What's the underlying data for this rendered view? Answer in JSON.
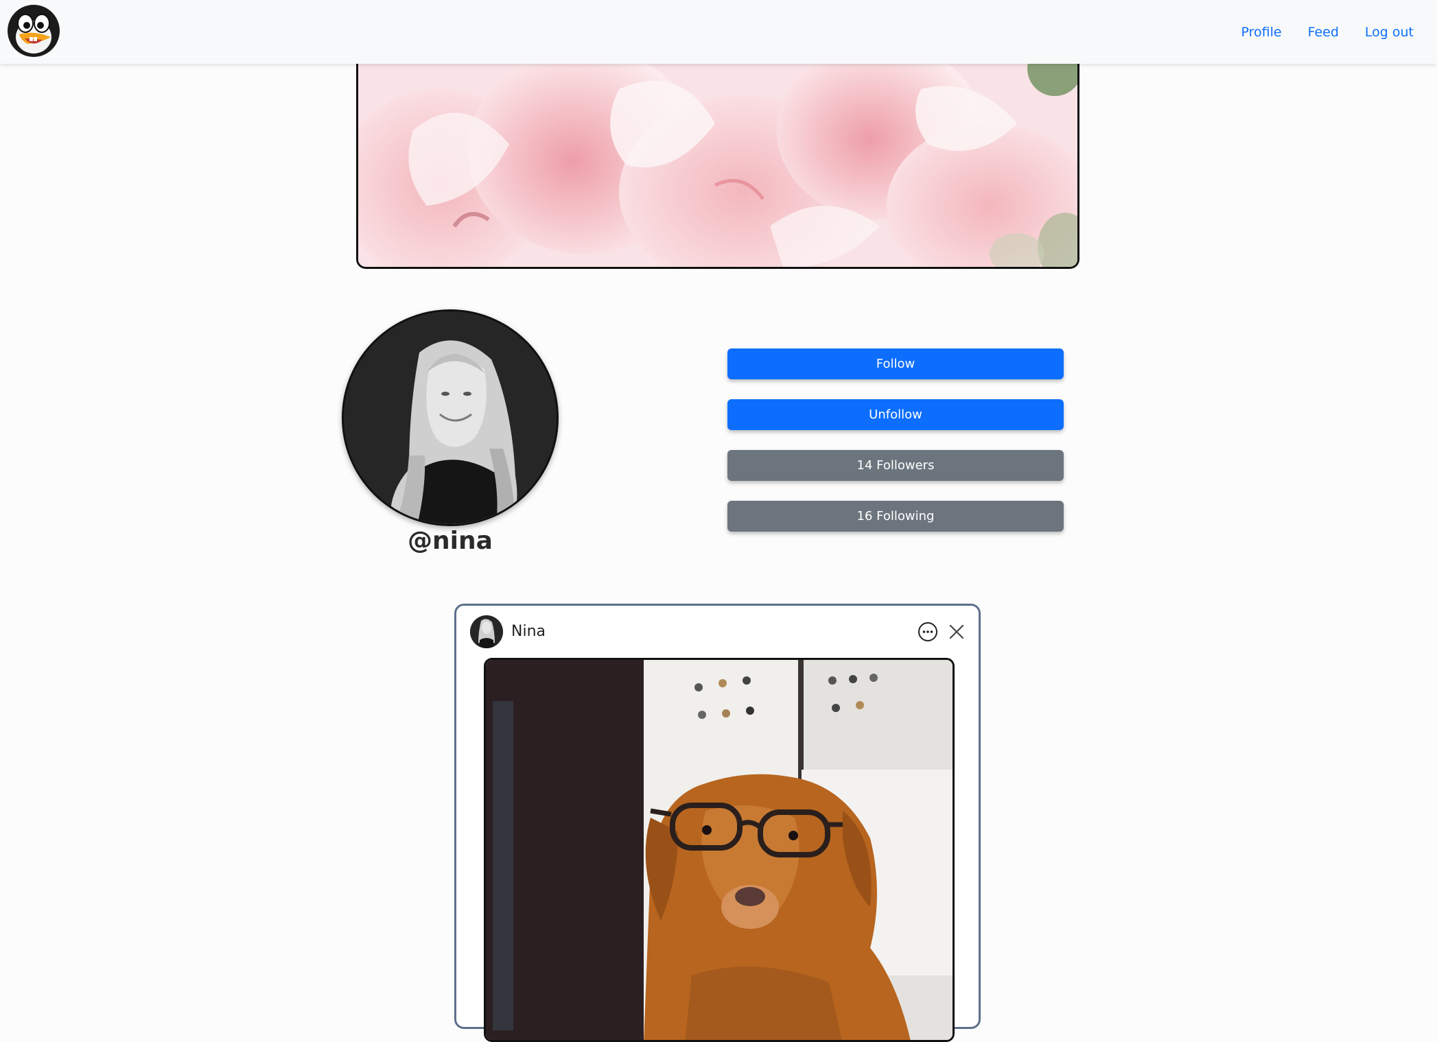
{
  "nav": {
    "logo_icon": "penguin-logo-icon",
    "links": {
      "profile": "Profile",
      "feed": "Feed",
      "logout": "Log out"
    },
    "link_color": "#0d6efd"
  },
  "profile": {
    "handle": "@nina",
    "cover_image": "pink-carnation-flowers-photo",
    "avatar_image": "woman-portrait-bw-photo"
  },
  "actions": {
    "follow": "Follow",
    "unfollow": "Unfollow",
    "followers": "14 Followers",
    "following": "16 Following",
    "primary_color": "#0d6efd",
    "secondary_color": "#6c757d"
  },
  "post": {
    "author": "Nina",
    "more_icon": "ellipsis-circle-icon",
    "close_icon": "close-icon",
    "image": "dog-wearing-glasses-photo"
  }
}
